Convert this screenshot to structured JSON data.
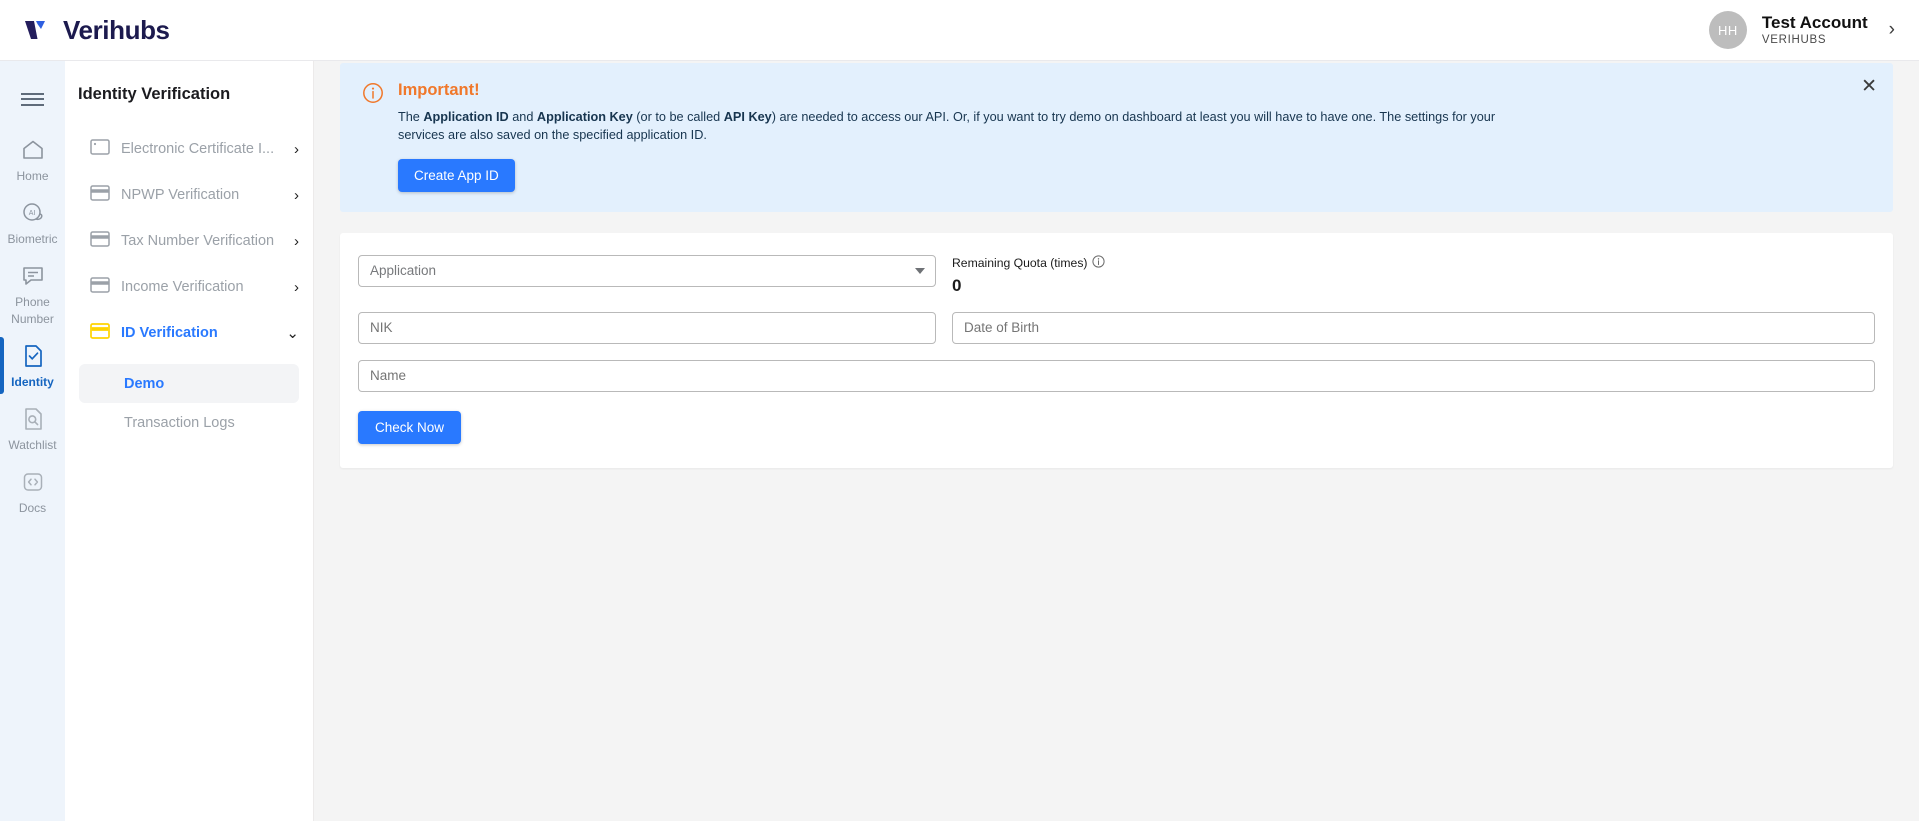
{
  "topbar": {
    "brand": "Verihubs",
    "account": {
      "initials": "HH",
      "name": "Test Account",
      "org": "VERIHUBS",
      "chevron": "›"
    }
  },
  "rail": {
    "items": [
      {
        "label": "Home",
        "icon": "home-icon",
        "active": false
      },
      {
        "label": "Biometric",
        "icon": "ai-face-icon",
        "active": false
      },
      {
        "label": "Phone Number",
        "icon": "message-icon",
        "active": false
      },
      {
        "label": "Identity",
        "icon": "document-check-icon",
        "active": true
      },
      {
        "label": "Watchlist",
        "icon": "document-search-icon",
        "active": false
      },
      {
        "label": "Docs",
        "icon": "code-brackets-icon",
        "active": false
      }
    ]
  },
  "subnav": {
    "title": "Identity Verification",
    "items": [
      {
        "label": "Electronic Certificate I...",
        "icon": "card-dot-icon",
        "chevron": "›",
        "current": false
      },
      {
        "label": "NPWP Verification",
        "icon": "card-icon",
        "chevron": "›",
        "current": false
      },
      {
        "label": "Tax Number Verification",
        "icon": "card-icon",
        "chevron": "›",
        "current": false
      },
      {
        "label": "Income Verification",
        "icon": "card-icon",
        "chevron": "›",
        "current": false
      },
      {
        "label": "ID Verification",
        "icon": "card-icon-yellow",
        "chevron": "⌄",
        "current": true
      }
    ],
    "submenu": [
      {
        "label": "Demo",
        "active": true
      },
      {
        "label": "Transaction Logs",
        "active": false
      }
    ]
  },
  "alert": {
    "icon": "info-circle-icon",
    "title": "Important!",
    "text_parts": {
      "p1": "The ",
      "b1": "Application ID",
      "p2": " and ",
      "b2": "Application Key",
      "p3": " (or to be called ",
      "b3": "API Key",
      "p4": ") are needed to access our API. Or, if you want to try demo on dashboard at least you will have to have one. The settings for your services are also saved on the specified application ID."
    },
    "create_button": "Create App ID",
    "close_icon": "✕"
  },
  "form": {
    "application_select": "Application",
    "quota_label": "Remaining Quota (times)",
    "quota_info_icon": "info-icon",
    "quota_value": "0",
    "nik_placeholder": "NIK",
    "dob_placeholder": "Date of Birth",
    "name_placeholder": "Name",
    "check_button": "Check Now"
  },
  "colors": {
    "accent_blue": "#2979ff",
    "alert_bg": "#e3f0fd",
    "alert_orange": "#f0782b",
    "rail_bg": "#eef4fb",
    "active_blue": "#1565c0",
    "yellow": "#ffd400"
  }
}
